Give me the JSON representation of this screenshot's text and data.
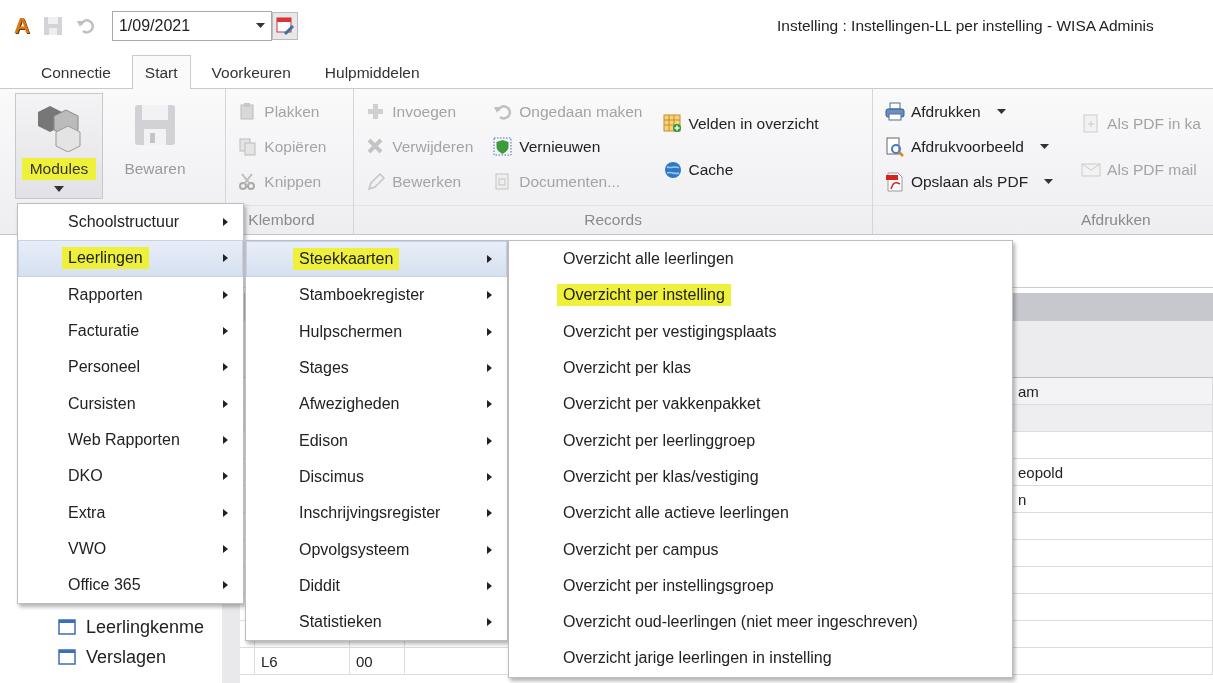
{
  "app_logo": "A",
  "toolbar": {
    "date": "1/09/2021"
  },
  "window_title": "Instelling : Instellingen-LL per instelling - WISA Adminis",
  "tabs": [
    {
      "label": "Connectie",
      "selected": false
    },
    {
      "label": "Start",
      "selected": true
    },
    {
      "label": "Voorkeuren",
      "selected": false
    },
    {
      "label": "Hulpmiddelen",
      "selected": false
    }
  ],
  "ribbon": {
    "large_buttons": [
      {
        "label": "Modules",
        "disabled": false,
        "marked": true,
        "dropdown": true
      },
      {
        "label": "Bewaren",
        "disabled": true,
        "marked": false,
        "dropdown": false
      }
    ],
    "groups": [
      {
        "label": "Klembord",
        "columns": [
          [
            {
              "label": "Plakken",
              "disabled": true,
              "dropdown": false
            },
            {
              "label": "Kopiëren",
              "disabled": true,
              "dropdown": false
            },
            {
              "label": "Knippen",
              "disabled": true,
              "dropdown": false
            }
          ]
        ]
      },
      {
        "label": "Records",
        "columns": [
          [
            {
              "label": "Invoegen",
              "disabled": true,
              "dropdown": false
            },
            {
              "label": "Verwijderen",
              "disabled": true,
              "dropdown": false
            },
            {
              "label": "Bewerken",
              "disabled": true,
              "dropdown": false
            }
          ],
          [
            {
              "label": "Ongedaan maken",
              "disabled": true,
              "dropdown": false
            },
            {
              "label": "Vernieuwen",
              "disabled": false,
              "dropdown": false
            },
            {
              "label": "Documenten...",
              "disabled": true,
              "dropdown": false
            }
          ],
          [
            {
              "label": "Velden in overzicht",
              "disabled": false,
              "dropdown": false
            },
            {
              "label": "Cache",
              "disabled": false,
              "dropdown": false
            }
          ]
        ]
      },
      {
        "label": "Afdrukken",
        "columns": [
          [
            {
              "label": "Afdrukken",
              "disabled": false,
              "dropdown": true
            },
            {
              "label": "Afdrukvoorbeeld",
              "disabled": false,
              "dropdown": true
            },
            {
              "label": "Opslaan als PDF",
              "disabled": false,
              "dropdown": true
            }
          ],
          [
            {
              "label": "Als PDF in ka",
              "disabled": true,
              "dropdown": false
            },
            {
              "label": "Als PDF mail",
              "disabled": true,
              "dropdown": false
            }
          ]
        ]
      }
    ]
  },
  "sidebar": {
    "items": [
      "Leerlingkenme",
      "Verslagen"
    ]
  },
  "table": {
    "header": {
      "column_5": "am"
    },
    "rows": [
      {},
      {},
      {
        "column_5": "eopold"
      },
      {
        "column_5": "n"
      },
      {},
      {},
      {},
      {},
      {},
      {
        "column_1": "L6",
        "column_2": "00"
      }
    ]
  },
  "menus": [
    {
      "items": [
        {
          "label": "Schoolstructuur",
          "selected": false,
          "marked": false,
          "submenu": true
        },
        {
          "label": "Leerlingen",
          "selected": true,
          "marked": true,
          "submenu": true
        },
        {
          "label": "Rapporten",
          "selected": false,
          "marked": false,
          "submenu": true
        },
        {
          "label": "Facturatie",
          "selected": false,
          "marked": false,
          "submenu": true
        },
        {
          "label": "Personeel",
          "selected": false,
          "marked": false,
          "submenu": true
        },
        {
          "label": "Cursisten",
          "selected": false,
          "marked": false,
          "submenu": true
        },
        {
          "label": "Web Rapporten",
          "selected": false,
          "marked": false,
          "submenu": true
        },
        {
          "label": "DKO",
          "selected": false,
          "marked": false,
          "submenu": true
        },
        {
          "label": "Extra",
          "selected": false,
          "marked": false,
          "submenu": true
        },
        {
          "label": "VWO",
          "selected": false,
          "marked": false,
          "submenu": true
        },
        {
          "label": "Office 365",
          "selected": false,
          "marked": false,
          "submenu": true
        }
      ]
    },
    {
      "items": [
        {
          "label": "Steekkaarten",
          "selected": true,
          "marked": true,
          "submenu": true
        },
        {
          "label": "Stamboekregister",
          "selected": false,
          "marked": false,
          "submenu": true
        },
        {
          "label": "Hulpschermen",
          "selected": false,
          "marked": false,
          "submenu": true
        },
        {
          "label": "Stages",
          "selected": false,
          "marked": false,
          "submenu": true
        },
        {
          "label": "Afwezigheden",
          "selected": false,
          "marked": false,
          "submenu": true
        },
        {
          "label": "Edison",
          "selected": false,
          "marked": false,
          "submenu": true
        },
        {
          "label": "Discimus",
          "selected": false,
          "marked": false,
          "submenu": true
        },
        {
          "label": "Inschrijvingsregister",
          "selected": false,
          "marked": false,
          "submenu": true
        },
        {
          "label": "Opvolgsysteem",
          "selected": false,
          "marked": false,
          "submenu": true
        },
        {
          "label": "Diddit",
          "selected": false,
          "marked": false,
          "submenu": true
        },
        {
          "label": "Statistieken",
          "selected": false,
          "marked": false,
          "submenu": true
        }
      ]
    },
    {
      "items": [
        {
          "label": "Overzicht alle leerlingen",
          "selected": false,
          "marked": false,
          "submenu": false
        },
        {
          "label": "Overzicht per instelling",
          "selected": false,
          "marked": true,
          "submenu": false
        },
        {
          "label": "Overzicht per vestigingsplaats",
          "selected": false,
          "marked": false,
          "submenu": false
        },
        {
          "label": "Overzicht per klas",
          "selected": false,
          "marked": false,
          "submenu": false
        },
        {
          "label": "Overzicht per vakkenpakket",
          "selected": false,
          "marked": false,
          "submenu": false
        },
        {
          "label": "Overzicht per leerlinggroep",
          "selected": false,
          "marked": false,
          "submenu": false
        },
        {
          "label": "Overzicht per klas/vestiging",
          "selected": false,
          "marked": false,
          "submenu": false
        },
        {
          "label": "Overzicht alle actieve leerlingen",
          "selected": false,
          "marked": false,
          "submenu": false
        },
        {
          "label": "Overzicht per campus",
          "selected": false,
          "marked": false,
          "submenu": false
        },
        {
          "label": "Overzicht per instellingsgroep",
          "selected": false,
          "marked": false,
          "submenu": false
        },
        {
          "label": "Overzicht oud-leerlingen (niet meer ingeschreven)",
          "selected": false,
          "marked": false,
          "submenu": false
        },
        {
          "label": "Overzicht jarige leerlingen in instelling",
          "selected": false,
          "marked": false,
          "submenu": false
        }
      ]
    }
  ]
}
